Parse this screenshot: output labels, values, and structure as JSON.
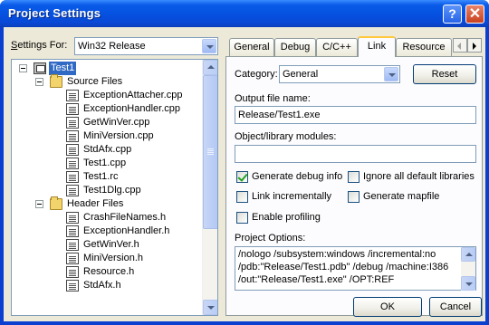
{
  "window": {
    "title": "Project Settings",
    "help_glyph": "?",
    "close_glyph": "✕"
  },
  "settings_for": {
    "label_prefix": "",
    "label_u": "S",
    "label_rest": "ettings For:",
    "value": "Win32 Release"
  },
  "tree": {
    "root": "Test1",
    "groups": [
      {
        "name": "Source Files",
        "files": [
          "ExceptionAttacher.cpp",
          "ExceptionHandler.cpp",
          "GetWinVer.cpp",
          "MiniVersion.cpp",
          "StdAfx.cpp",
          "Test1.cpp",
          "Test1.rc",
          "Test1Dlg.cpp"
        ]
      },
      {
        "name": "Header Files",
        "files": [
          "CrashFileNames.h",
          "ExceptionHandler.h",
          "GetWinVer.h",
          "MiniVersion.h",
          "Resource.h",
          "StdAfx.h"
        ]
      }
    ]
  },
  "tabs": [
    "General",
    "Debug",
    "C/C++",
    "Link",
    "Resource"
  ],
  "active_tab": "Link",
  "link": {
    "category_label": "Category:",
    "category_value": "General",
    "reset_label": "Reset",
    "output_label": "Output file name:",
    "output_value": "Release/Test1.exe",
    "modules_label": "Object/library modules:",
    "modules_value": "",
    "checks": {
      "generate_debug": {
        "label": "Generate debug info",
        "checked": true
      },
      "ignore_libs": {
        "label": "Ignore all default libraries",
        "checked": false
      },
      "link_incremental": {
        "label": "Link incrementally",
        "checked": false
      },
      "generate_mapfile": {
        "label": "Generate mapfile",
        "checked": false
      },
      "enable_profiling": {
        "label": "Enable profiling",
        "checked": false
      }
    },
    "options_label": "Project Options:",
    "options_lines": [
      "/nologo /subsystem:windows /incremental:no",
      "/pdb:\"Release/Test1.pdb\" /debug /machine:I386",
      "/out:\"Release/Test1.exe\"  /OPT:REF"
    ]
  },
  "buttons": {
    "ok": "OK",
    "cancel": "Cancel"
  }
}
